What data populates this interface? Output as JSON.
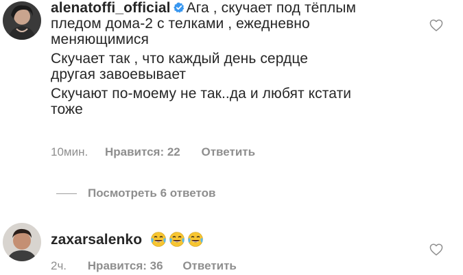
{
  "comment1": {
    "username": "alenatoffi_official",
    "verified_icon": "verified-badge-icon",
    "text_line1": "Ага , скучает под тёплым",
    "text_line2": "пледом дома-2 с телками , ежедневно",
    "text_line3": "меняющимися",
    "text_line4": "Скучает так , что каждый день сердце",
    "text_line5": "другая завоевывает",
    "text_line6": "Скучают по-моему не так..да и любят кстати",
    "text_line7": "тоже",
    "time": "10мин.",
    "likes": "Нравится: 22",
    "reply": "Ответить",
    "like_icon": "heart-outline-icon"
  },
  "view_replies": {
    "label": "Посмотреть 6 ответов"
  },
  "comment2": {
    "username": "zaxarsalenko",
    "emoji_icon": "face-with-tears-of-joy-emoji",
    "emoji_count": 3,
    "time": "2ч.",
    "likes": "Нравится: 36",
    "reply": "Ответить",
    "like_icon": "heart-outline-icon"
  },
  "colors": {
    "primary_text": "#262626",
    "secondary_text": "#8e8e8e",
    "verified_blue": "#3897f0"
  }
}
